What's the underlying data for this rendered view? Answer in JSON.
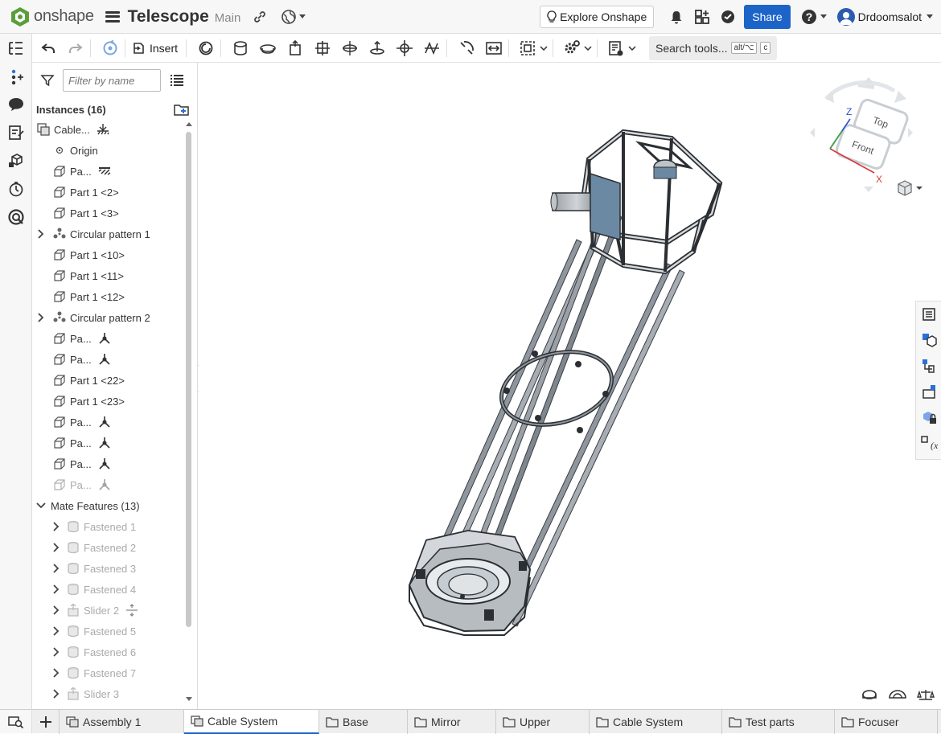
{
  "app": {
    "brand": "onshape",
    "brand_color": "#1d64c9"
  },
  "document": {
    "title": "Telescope",
    "branch": "Main"
  },
  "header": {
    "explore_label": "Explore Onshape",
    "share_label": "Share",
    "user_name": "Drdoomsalot",
    "help_label": "?"
  },
  "toolbar": {
    "insert_label": "Insert",
    "search_label": "Search tools...",
    "search_shortcut_1": "alt/⌥",
    "search_shortcut_2": "c"
  },
  "panel": {
    "filter_placeholder": "Filter by name",
    "instances_header": "Instances (16)",
    "instances": [
      {
        "label": "Cable...",
        "icon": "assembly-icon",
        "badge": "fixed-icon"
      },
      {
        "label": "Origin",
        "icon": "origin-icon"
      },
      {
        "label": "Pa...",
        "icon": "part-icon",
        "badge": "fixed-striped-icon"
      },
      {
        "label": "Part 1 <2>",
        "icon": "part-icon"
      },
      {
        "label": "Part 1 <3>",
        "icon": "part-icon"
      },
      {
        "label": "Circular pattern 1",
        "icon": "pattern-icon",
        "expandable": true
      },
      {
        "label": "Part 1 <10>",
        "icon": "part-icon"
      },
      {
        "label": "Part 1 <11>",
        "icon": "part-icon"
      },
      {
        "label": "Part 1 <12>",
        "icon": "part-icon"
      },
      {
        "label": "Circular pattern 2",
        "icon": "pattern-icon",
        "expandable": true
      },
      {
        "label": "Pa...",
        "icon": "part-icon",
        "badge": "mate-connector-icon"
      },
      {
        "label": "Pa...",
        "icon": "part-icon",
        "badge": "mate-connector-icon"
      },
      {
        "label": "Part 1 <22>",
        "icon": "part-icon"
      },
      {
        "label": "Part 1 <23>",
        "icon": "part-icon"
      },
      {
        "label": "Pa...",
        "icon": "part-icon",
        "badge": "mate-connector-icon"
      },
      {
        "label": "Pa...",
        "icon": "part-icon",
        "badge": "mate-connector-icon"
      },
      {
        "label": "Pa...",
        "icon": "part-icon",
        "badge": "mate-connector-icon"
      },
      {
        "label": "Pa...",
        "icon": "part-icon",
        "badge": "mate-connector-icon",
        "dim": true
      }
    ],
    "mates_header": "Mate Features (13)",
    "mates": [
      {
        "label": "Fastened 1",
        "icon": "fastened-icon"
      },
      {
        "label": "Fastened 2",
        "icon": "fastened-icon"
      },
      {
        "label": "Fastened 3",
        "icon": "fastened-icon"
      },
      {
        "label": "Fastened 4",
        "icon": "fastened-icon"
      },
      {
        "label": "Slider 2",
        "icon": "slider-icon",
        "badge": "slider-badge-icon"
      },
      {
        "label": "Fastened 5",
        "icon": "fastened-icon"
      },
      {
        "label": "Fastened 6",
        "icon": "fastened-icon"
      },
      {
        "label": "Fastened 7",
        "icon": "fastened-icon"
      },
      {
        "label": "Slider 3",
        "icon": "slider-icon"
      }
    ]
  },
  "viewcube": {
    "top_label": "Top",
    "front_label": "Front",
    "x_axis": "X",
    "z_axis": "Z"
  },
  "tabs": [
    {
      "label": "Assembly 1",
      "icon": "assembly-tab-icon",
      "active": false
    },
    {
      "label": "Cable System",
      "icon": "assembly-tab-icon",
      "active": true
    },
    {
      "label": "Base",
      "icon": "folder-icon",
      "active": false
    },
    {
      "label": "Mirror",
      "icon": "folder-icon",
      "active": false
    },
    {
      "label": "Upper",
      "icon": "folder-icon",
      "active": false
    },
    {
      "label": "Cable System",
      "icon": "folder-icon",
      "active": false
    },
    {
      "label": "Test parts",
      "icon": "folder-icon",
      "active": false
    },
    {
      "label": "Focuser",
      "icon": "folder-icon",
      "active": false
    }
  ]
}
